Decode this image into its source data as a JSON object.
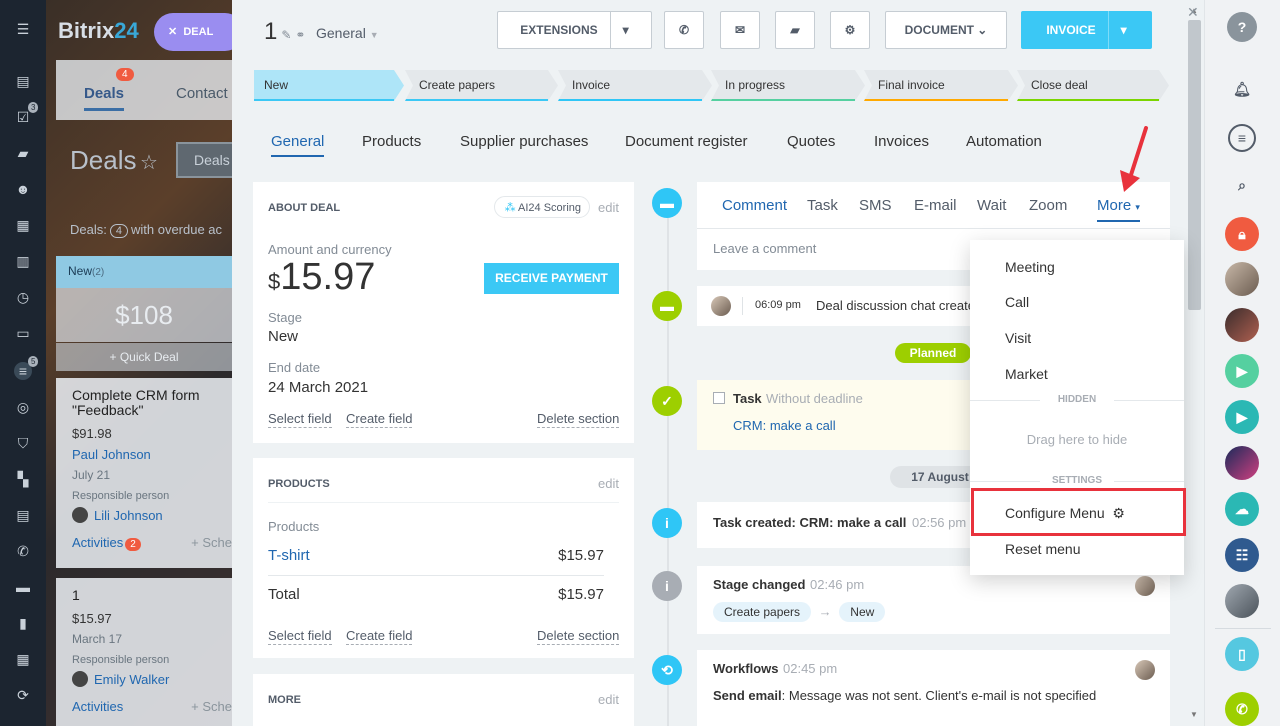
{
  "left_rail": {
    "badges": [
      "3",
      "5"
    ]
  },
  "background": {
    "logo_text": "Bitrix",
    "logo_num": "24",
    "deal_chip": "DEAL",
    "tabs": [
      "Deals",
      "Contact"
    ],
    "tab_badge": "4",
    "page_title": "Deals",
    "btn_label": "Deals",
    "subtitle_prefix": "Deals:",
    "subtitle_count": "4",
    "subtitle_suffix": "with overdue ac",
    "column_name": "New",
    "column_count": "(2)",
    "column_sum": "$108",
    "quick_deal": "+ Quick Deal",
    "cards": [
      {
        "title": "Complete CRM form \"Feedback\"",
        "price": "$91.98",
        "contact": "Paul Johnson",
        "date": "July 21",
        "resp_label": "Responsible person",
        "person": "Lili Johnson",
        "activities": "Activities",
        "activity_count": "2",
        "schedule": "+ Sche"
      },
      {
        "title": "1",
        "price": "$15.97",
        "date": "March 17",
        "resp_label": "Responsible person",
        "person": "Emily Walker",
        "activities": "Activities",
        "schedule": "+ Sche"
      }
    ]
  },
  "header": {
    "deal_id": "1",
    "category": "General",
    "extensions": "EXTENSIONS",
    "document": "DOCUMENT",
    "invoice": "INVOICE"
  },
  "stages": [
    {
      "label": "New",
      "color": "#aee5f8",
      "bar": "#3bc8f5"
    },
    {
      "label": "Create papers",
      "color": "#e4e8eb",
      "bar": "#3bc8f5"
    },
    {
      "label": "Invoice",
      "color": "#e4e8eb",
      "bar": "#2fc6f6"
    },
    {
      "label": "In progress",
      "color": "#e4e8eb",
      "bar": "#55d0a0"
    },
    {
      "label": "Final invoice",
      "color": "#e4e8eb",
      "bar": "#ffa900"
    },
    {
      "label": "Close deal",
      "color": "#e4e8eb",
      "bar": "#7bd500"
    }
  ],
  "tabs": [
    "General",
    "Products",
    "Supplier purchases",
    "Document register",
    "Quotes",
    "Invoices",
    "Automation"
  ],
  "about": {
    "heading": "ABOUT DEAL",
    "ai_chip": "AI24 Scoring",
    "edit": "edit",
    "amount_label": "Amount and currency",
    "currency": "$",
    "amount": "15.97",
    "receive_payment": "RECEIVE PAYMENT",
    "stage_label": "Stage",
    "stage_value": "New",
    "end_label": "End date",
    "end_value": "24 March 2021",
    "select_field": "Select field",
    "create_field": "Create field",
    "delete_section": "Delete section"
  },
  "products": {
    "heading": "PRODUCTS",
    "edit": "edit",
    "col_label": "Products",
    "item": "T-shirt",
    "item_price": "$15.97",
    "total_label": "Total",
    "total": "$15.97",
    "select_field": "Select field",
    "create_field": "Create field",
    "delete_section": "Delete section"
  },
  "more_card": {
    "heading": "MORE",
    "edit": "edit"
  },
  "timeline": {
    "comment_tabs": [
      "Comment",
      "Task",
      "SMS",
      "E-mail",
      "Wait",
      "Zoom"
    ],
    "more_tab": "More",
    "placeholder": "Leave a comment",
    "chat_time": "06:09 pm",
    "chat_text": "Deal discussion chat create",
    "planned": "Planned",
    "task_label": "Task",
    "task_sub": "Without deadline",
    "task_link": "CRM: make a call",
    "date_chip": "17 August",
    "created_text": "Task created: CRM: make a call",
    "created_time": "02:56 pm",
    "stage_title": "Stage changed",
    "stage_time": "02:46 pm",
    "stage_from": "Create papers",
    "stage_to": "New",
    "wf_title": "Workflows",
    "wf_time": "02:45 pm",
    "wf_label": "Send email",
    "wf_text": ": Message was not sent. Client's e-mail is not specified"
  },
  "menu": {
    "items": [
      "Meeting",
      "Call",
      "Visit",
      "Market"
    ],
    "hidden_label": "HIDDEN",
    "drag_hint": "Drag here to hide",
    "settings_label": "SETTINGS",
    "configure": "Configure Menu",
    "reset": "Reset menu"
  },
  "right_bar": {
    "help": "?"
  },
  "colors": {
    "accent_blue": "#3bc8f5",
    "link": "#2067b0",
    "planned": "#9dcf00",
    "highlight": "#e8323c"
  }
}
